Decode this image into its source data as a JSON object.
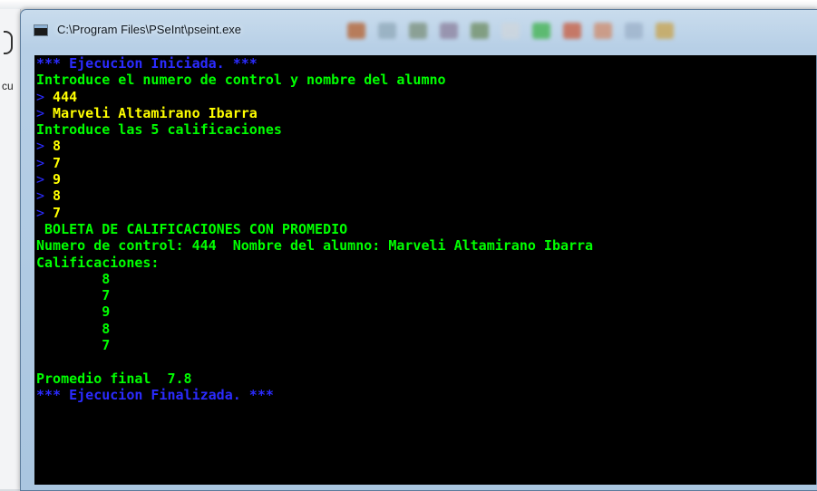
{
  "window": {
    "title": "C:\\Program Files\\PSeInt\\pseint.exe"
  },
  "background": {
    "left_label": "cu"
  },
  "console": {
    "prompt_symbol": ">",
    "lines": [
      {
        "kind": "status",
        "text": "*** Ejecucion Iniciada. ***"
      },
      {
        "kind": "output",
        "text": "Introduce el numero de control y nombre del alumno"
      },
      {
        "kind": "input",
        "text": "444"
      },
      {
        "kind": "input",
        "text": "Marveli Altamirano Ibarra"
      },
      {
        "kind": "output",
        "text": "Introduce las 5 calificaciones"
      },
      {
        "kind": "input",
        "text": "8"
      },
      {
        "kind": "input",
        "text": "7"
      },
      {
        "kind": "input",
        "text": "9"
      },
      {
        "kind": "input",
        "text": "8"
      },
      {
        "kind": "input",
        "text": "7"
      },
      {
        "kind": "output",
        "text": " BOLETA DE CALIFICACIONES CON PROMEDIO"
      },
      {
        "kind": "output",
        "text": "Numero de control: 444  Nombre del alumno: Marveli Altamirano Ibarra"
      },
      {
        "kind": "output",
        "text": "Calificaciones:"
      },
      {
        "kind": "output",
        "text": "        8"
      },
      {
        "kind": "output",
        "text": "        7"
      },
      {
        "kind": "output",
        "text": "        9"
      },
      {
        "kind": "output",
        "text": "        8"
      },
      {
        "kind": "output",
        "text": "        7"
      },
      {
        "kind": "output",
        "text": ""
      },
      {
        "kind": "output",
        "text": "Promedio final  7.8"
      },
      {
        "kind": "status",
        "text": "*** Ejecucion Finalizada. ***"
      }
    ]
  },
  "colors": {
    "status": "#2b2bff",
    "output": "#00ff00",
    "input": "#ffff00",
    "background": "#000000"
  }
}
